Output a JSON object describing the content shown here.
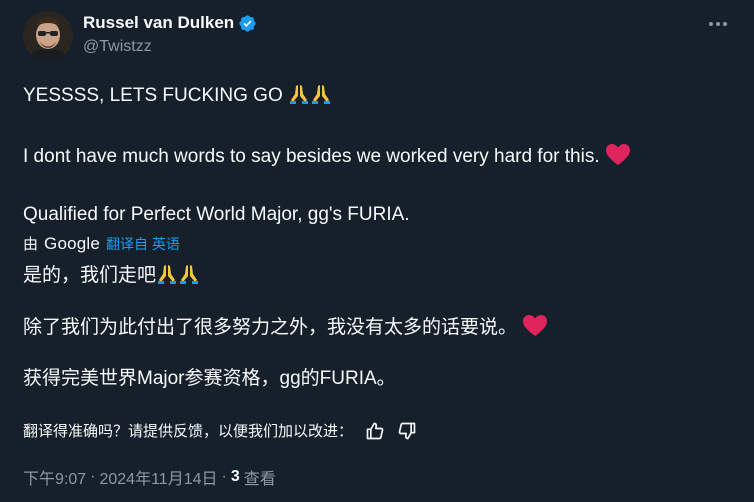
{
  "colors": {
    "background": "#15202b",
    "primary_text": "#f7f9f9",
    "secondary_text": "#8b98a5",
    "link": "#1d9bf0",
    "verified": "#1d9bf0",
    "heart": "#e0245e"
  },
  "author": {
    "display_name": "Russel van Dulken",
    "handle": "@Twistzz",
    "verified_icon": "verified-badge-icon"
  },
  "tweet": {
    "line1": "YESSSS, LETS FUCKING GO",
    "line2": "I dont have much words to say besides we worked very hard for this.",
    "line3": "Qualified for Perfect World Major, gg's FURIA."
  },
  "translation": {
    "by_label": "由",
    "provider": "Google",
    "link_label": "翻译自 英语",
    "line1": "是的，我们走吧",
    "line2": "除了我们为此付出了很多努力之外，我没有太多的话要说。",
    "line3": "获得完美世界Major参赛资格，gg的FURIA。"
  },
  "feedback": {
    "prompt": "翻译得准确吗？请提供反馈，以便我们加以改进：",
    "thumbs_up_icon": "thumbs-up-icon",
    "thumbs_down_icon": "thumbs-down-icon"
  },
  "meta": {
    "time": "下午9:07",
    "separator1": "·",
    "date": "2024年11月14日",
    "separator2": "·",
    "views_count": "3",
    "views_label": "查看"
  }
}
